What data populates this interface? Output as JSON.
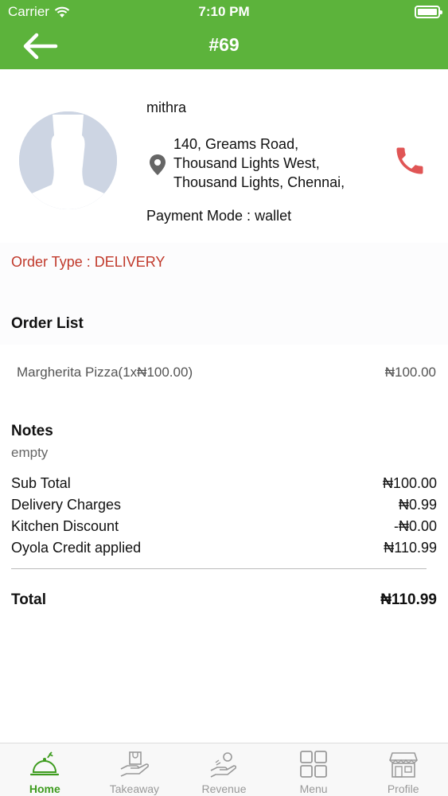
{
  "status_bar": {
    "carrier": "Carrier",
    "time": "7:10 PM"
  },
  "header": {
    "title": "#69",
    "back_icon": "arrow-left-icon"
  },
  "customer": {
    "name": "mithra",
    "address_lines": [
      "140, Greams Road,",
      "Thousand Lights West,",
      "Thousand Lights, Chennai,"
    ],
    "payment_mode": "Payment Mode : wallet",
    "call_icon": "phone-icon"
  },
  "order": {
    "type_label": "Order Type : DELIVERY",
    "list_title": "Order List",
    "items": [
      {
        "name": "Margherita Pizza(1x₦100.00)",
        "price": "₦100.00"
      }
    ]
  },
  "notes": {
    "title": "Notes",
    "text": "empty"
  },
  "summary": [
    {
      "label": "Sub Total",
      "value": "₦100.00"
    },
    {
      "label": "Delivery Charges",
      "value": "₦0.99"
    },
    {
      "label": "Kitchen Discount",
      "value": "-₦0.00"
    },
    {
      "label": "Oyola Credit applied",
      "value": "₦110.99"
    }
  ],
  "total": {
    "label": "Total",
    "value": "₦110.99"
  },
  "tabs": [
    {
      "label": "Home",
      "icon": "cloche-icon",
      "active": true
    },
    {
      "label": "Takeaway",
      "icon": "bag-hand-icon",
      "active": false
    },
    {
      "label": "Revenue",
      "icon": "revenue-hand-icon",
      "active": false
    },
    {
      "label": "Menu",
      "icon": "grid-icon",
      "active": false
    },
    {
      "label": "Profile",
      "icon": "store-icon",
      "active": false
    }
  ],
  "colors": {
    "primary": "#5cb33b",
    "accent_red": "#c0392b",
    "phone": "#e05555",
    "active_tab": "#3e9c1f"
  }
}
